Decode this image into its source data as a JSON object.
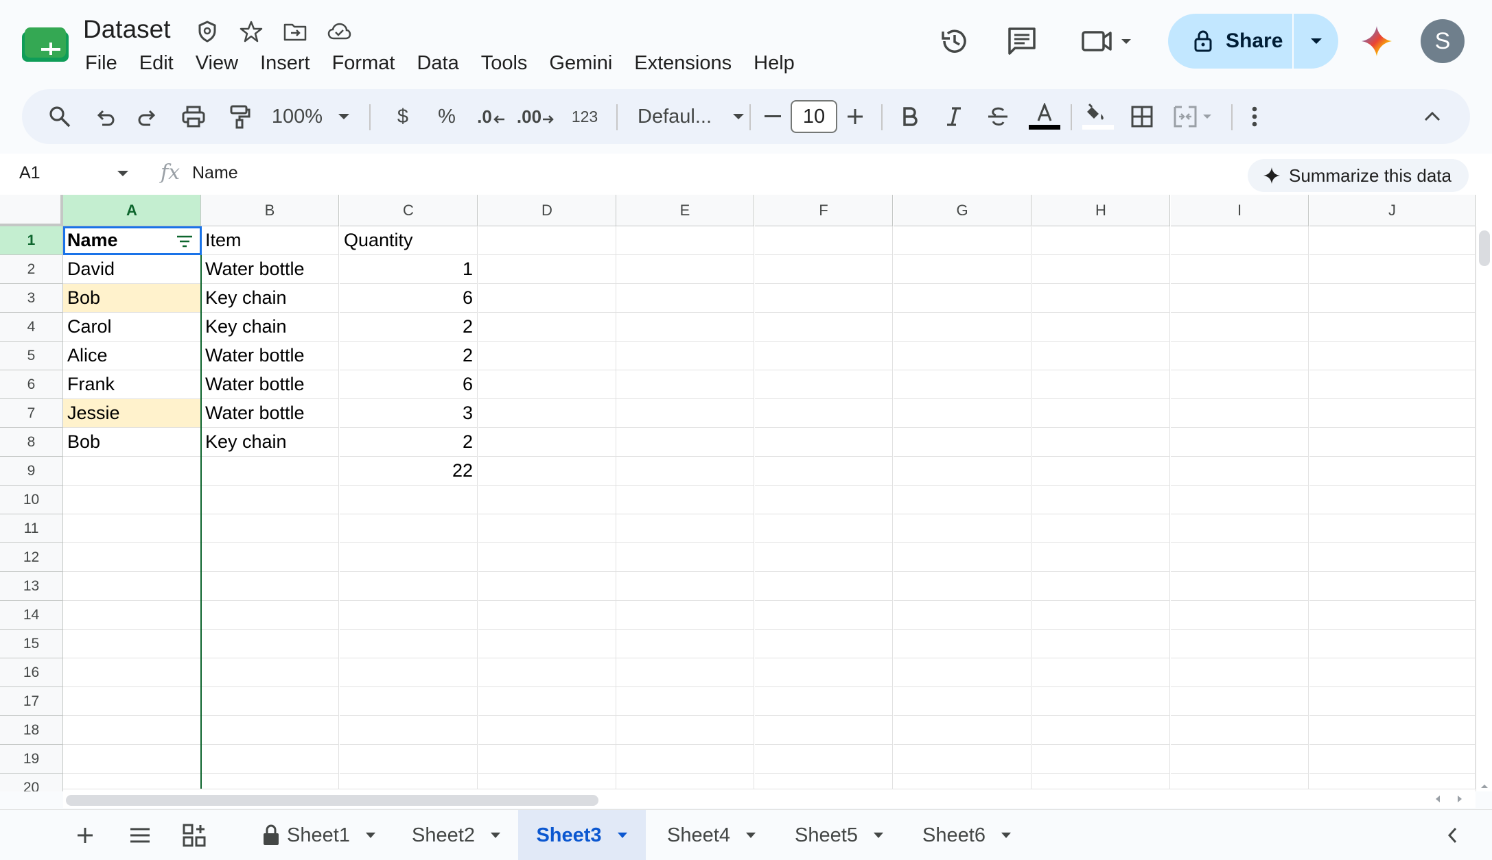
{
  "header": {
    "doc_title": "Dataset",
    "menu": [
      "File",
      "Edit",
      "View",
      "Insert",
      "Format",
      "Data",
      "Tools",
      "Gemini",
      "Extensions",
      "Help"
    ],
    "share_label": "Share",
    "avatar_letter": "S",
    "brand_color": "#0f9d58",
    "share_bg": "#c2e7ff"
  },
  "toolbar": {
    "zoom": "100%",
    "currency": "$",
    "percent": "%",
    "decrease_decimal": ".0",
    "increase_decimal": ".00",
    "number_format": "123",
    "font": "Defaul...",
    "font_size": "10"
  },
  "formula_bar": {
    "cell_ref": "A1",
    "fx": "fx",
    "content": "Name",
    "summarize_label": "Summarize this data"
  },
  "grid": {
    "columns": [
      "A",
      "B",
      "C",
      "D",
      "E",
      "F",
      "G",
      "H",
      "I",
      "J"
    ],
    "rows": [
      "1",
      "2",
      "3",
      "4",
      "5",
      "6",
      "7",
      "8",
      "9",
      "10",
      "11",
      "12",
      "13",
      "14",
      "15",
      "16",
      "17",
      "18",
      "19",
      "20"
    ],
    "data": [
      [
        "Name",
        "Item",
        "Quantity"
      ],
      [
        "David",
        "Water bottle",
        "1"
      ],
      [
        "Bob",
        "Key chain",
        "6"
      ],
      [
        "Carol",
        "Key chain",
        "2"
      ],
      [
        "Alice",
        "Water bottle",
        "2"
      ],
      [
        "Frank",
        "Water bottle",
        "6"
      ],
      [
        "Jessie",
        "Water bottle",
        "3"
      ],
      [
        "Bob",
        "Key chain",
        "2"
      ],
      [
        "",
        "",
        "22"
      ]
    ],
    "highlight_color": "#fff2cc",
    "selection_color": "#1a73e8"
  },
  "sheets": {
    "tabs": [
      "Sheet1",
      "Sheet2",
      "Sheet3",
      "Sheet4",
      "Sheet5",
      "Sheet6"
    ],
    "active": "Sheet3"
  }
}
